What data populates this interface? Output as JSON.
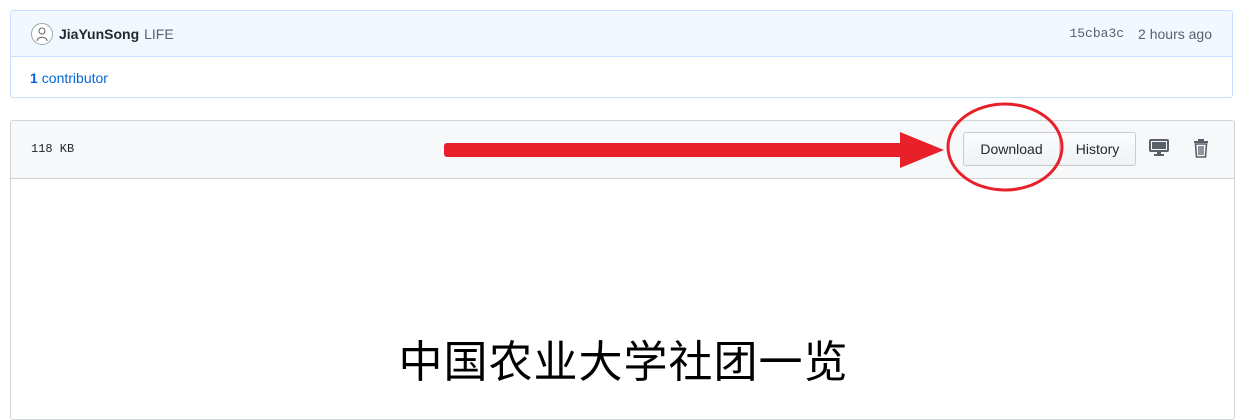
{
  "commit": {
    "author": "JiaYunSong",
    "message": "LIFE",
    "sha": "15cba3c",
    "time_ago": "2 hours ago"
  },
  "contributors": {
    "count": "1",
    "label": "contributor"
  },
  "file": {
    "size": "118 KB",
    "download_label": "Download",
    "history_label": "History",
    "content_title": "中国农业大学社团一览"
  },
  "icons": {
    "avatar": "avatar-icon",
    "desktop": "desktop-icon",
    "trash": "trash-icon"
  },
  "colors": {
    "link": "#0366d6",
    "annotation": "#e8202a",
    "commit_bg": "#f1f8ff",
    "header_bg": "#f6f8fa"
  }
}
